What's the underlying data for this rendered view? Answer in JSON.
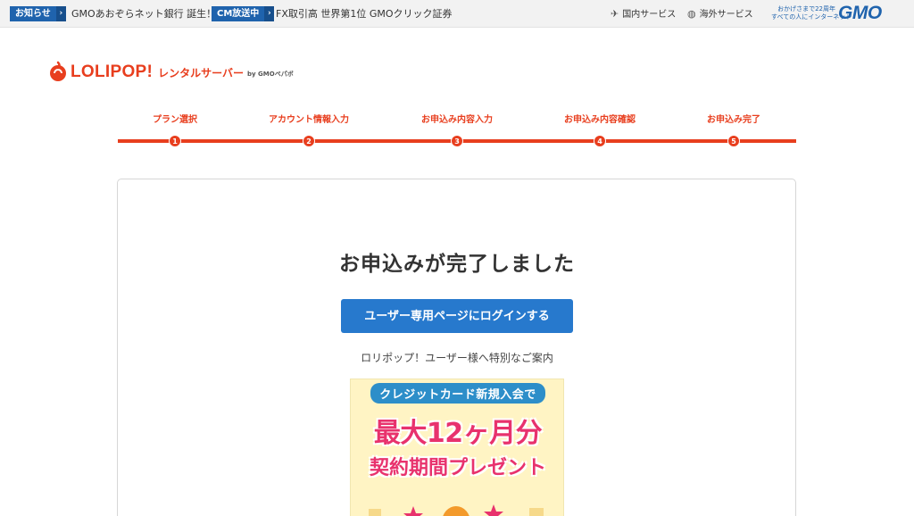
{
  "topbar": {
    "news": [
      {
        "tag": "お知らせ",
        "text": "GMOあおぞらネット銀行 誕生！"
      },
      {
        "tag": "CM放送中",
        "text": "FX取引高 世界第1位 GMOクリック証券"
      }
    ],
    "services": [
      {
        "label": "国内サービス",
        "icon": "plane-icon"
      },
      {
        "label": "海外サービス",
        "icon": "globe-icon"
      }
    ],
    "gmo_tagline_1": "おかげさまで22周年",
    "gmo_tagline_2": "すべての人にインターネット",
    "gmo_logo": "GMO"
  },
  "header": {
    "logo_text": "LOLIPOP!",
    "logo_sub": "レンタルサーバー",
    "logo_by": "by GMOペパボ",
    "brand_color": "#e83e1e"
  },
  "steps": [
    {
      "label": "プラン選択",
      "number": "1"
    },
    {
      "label": "アカウント情報入力",
      "number": "2"
    },
    {
      "label": "お申込み内容入力",
      "number": "3"
    },
    {
      "label": "お申込み内容確認",
      "number": "4"
    },
    {
      "label": "お申込み完了",
      "number": "5"
    }
  ],
  "main": {
    "title": "お申込みが完了しました",
    "login_button": "ユーザー専用ページにログインする",
    "special_text": "ロリポップ！ユーザー様へ特別なご案内"
  },
  "banner": {
    "top": "クレジットカード新規入会で",
    "main": "最大12ヶ月分",
    "sub": "契約期間プレゼント"
  },
  "colors": {
    "accent": "#e83e1e",
    "button": "#2779cd",
    "gmo_blue": "#1f63ad"
  }
}
